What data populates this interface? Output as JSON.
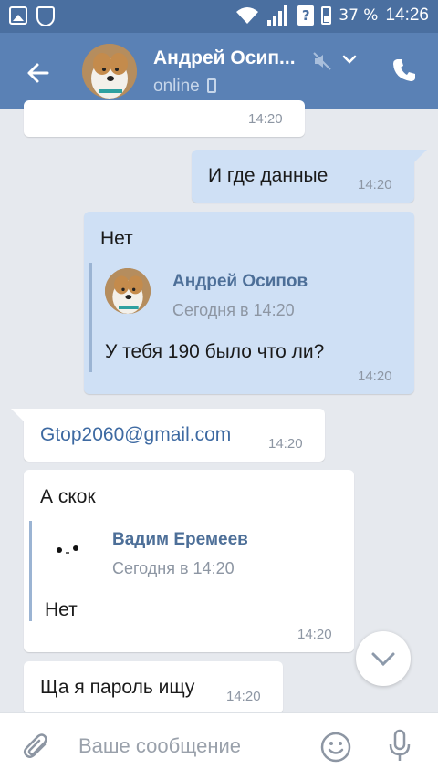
{
  "status_bar": {
    "battery": "37 %",
    "time": "14:26",
    "icons": [
      "gallery-icon",
      "shield-app-icon",
      "wifi-icon",
      "signal-icon",
      "unknown-sim-icon",
      "battery-icon"
    ]
  },
  "header": {
    "contact_name": "Андрей Осип...",
    "status": "online",
    "icons": [
      "back-arrow-icon",
      "muted-icon",
      "chevron-down-icon",
      "phone-icon"
    ]
  },
  "messages": [
    {
      "id": "m0",
      "direction": "in",
      "time": "14:20"
    },
    {
      "id": "m1",
      "direction": "out",
      "text": "И где данные",
      "time": "14:20"
    },
    {
      "id": "m2",
      "direction": "out",
      "text": "Нет",
      "time": "14:20",
      "forwarded": {
        "author": "Андрей Осипов",
        "date": "Сегодня в 14:20",
        "text": "У тебя 190 было что ли?"
      }
    },
    {
      "id": "m3",
      "direction": "in",
      "text": "Gtop2060@gmail.com",
      "time": "14:20",
      "is_link": true
    },
    {
      "id": "m4",
      "direction": "in",
      "text": "А скок",
      "time": "14:20",
      "forwarded": {
        "author": "Вадим Еремеев",
        "date": "Сегодня в 14:20",
        "text": "Нет"
      }
    },
    {
      "id": "m5",
      "direction": "in",
      "text": "Ща я пароль ищу",
      "time": "14:20"
    }
  ],
  "input": {
    "placeholder": "Ваше сообщение",
    "value": ""
  },
  "colors": {
    "header": "#5a81b5",
    "status_bar": "#4a6fa0",
    "background": "#e6e9ee",
    "outgoing_bubble": "#cfe0f5",
    "incoming_bubble": "#ffffff",
    "link": "#3e6aa2",
    "forward_author": "#4d6f98"
  }
}
